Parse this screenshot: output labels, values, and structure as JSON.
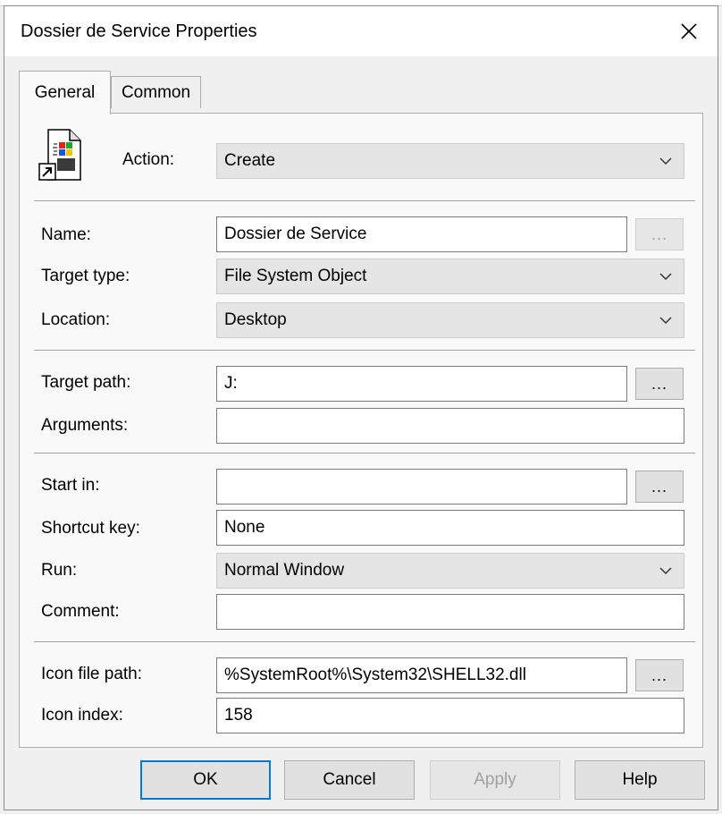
{
  "window": {
    "title": "Dossier de Service Properties"
  },
  "tabs": [
    {
      "label": "General",
      "active": true
    },
    {
      "label": "Common",
      "active": false
    }
  ],
  "general": {
    "action": {
      "label": "Action:",
      "value": "Create"
    },
    "name": {
      "label": "Name:",
      "value": "Dossier de Service",
      "browse": "..."
    },
    "target_type": {
      "label": "Target type:",
      "value": "File System Object"
    },
    "location": {
      "label": "Location:",
      "value": "Desktop"
    },
    "target_path": {
      "label": "Target path:",
      "value": "J:",
      "browse": "..."
    },
    "arguments": {
      "label": "Arguments:",
      "value": ""
    },
    "start_in": {
      "label": "Start in:",
      "value": "",
      "browse": "..."
    },
    "shortcut_key": {
      "label": "Shortcut key:",
      "value": "None"
    },
    "run": {
      "label": "Run:",
      "value": "Normal Window"
    },
    "comment": {
      "label": "Comment:",
      "value": ""
    },
    "icon_file_path": {
      "label": "Icon file path:",
      "value": "%SystemRoot%\\System32\\SHELL32.dll",
      "browse": "..."
    },
    "icon_index": {
      "label": "Icon index:",
      "value": "158"
    }
  },
  "buttons": {
    "ok": "OK",
    "cancel": "Cancel",
    "apply": "Apply",
    "help": "Help"
  },
  "colors": {
    "accent": "#0078d7",
    "disabled_text": "#a0a0a0",
    "combo_bg": "#e5e5e5"
  },
  "icons": [
    "close-icon",
    "shortcut-icon",
    "chevron-down-icon"
  ]
}
